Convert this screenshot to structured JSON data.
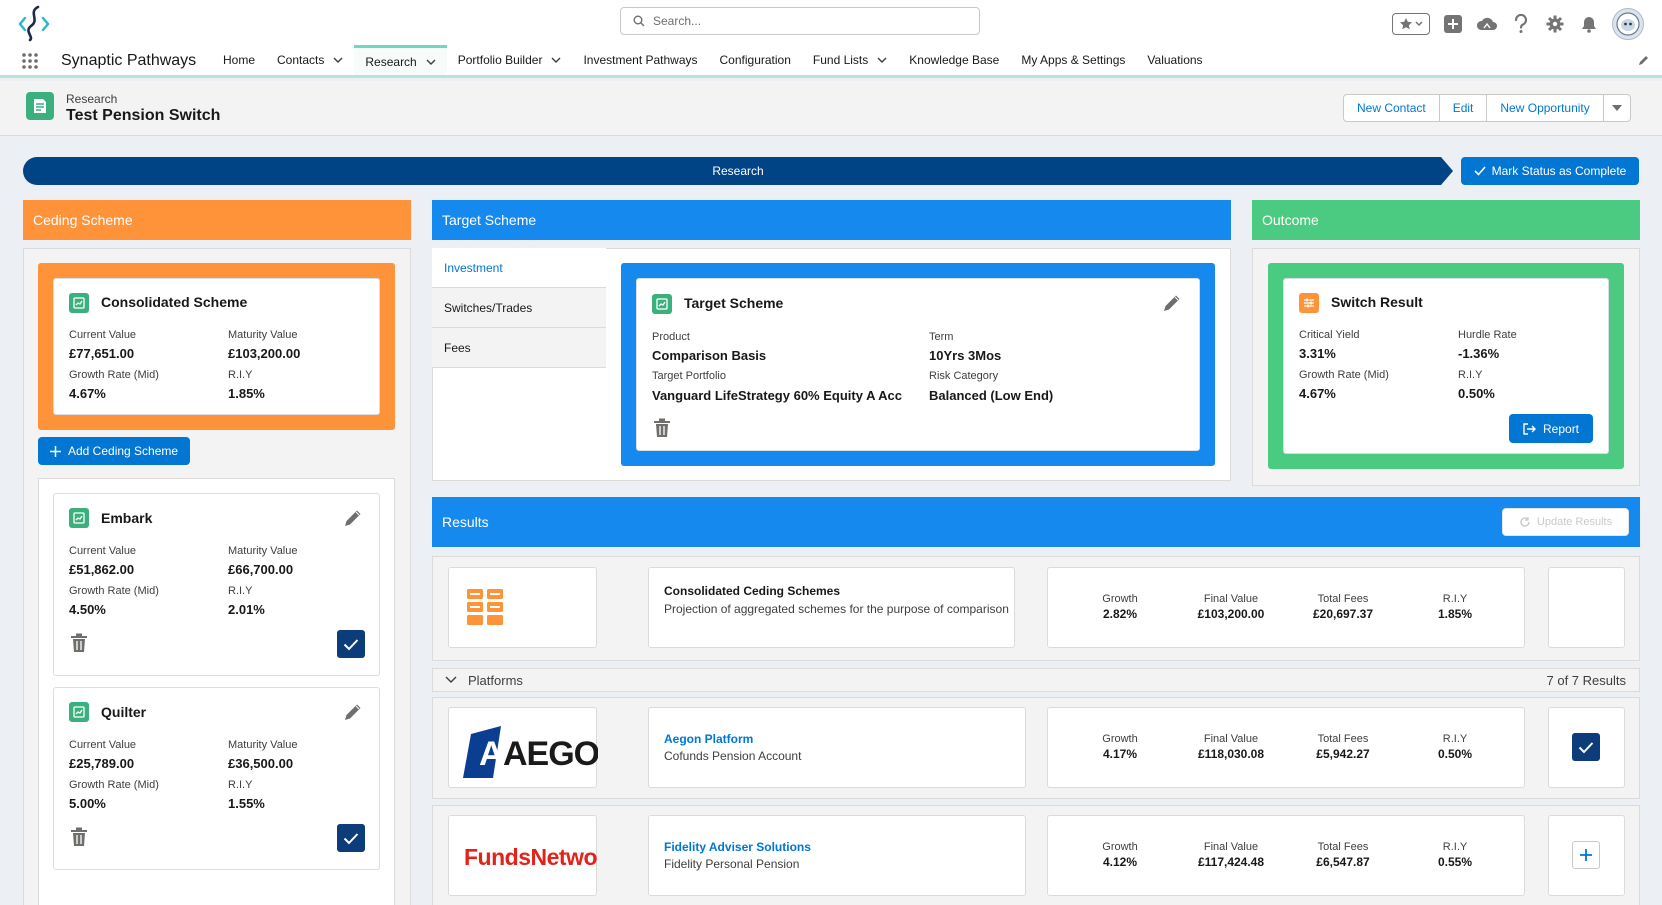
{
  "top": {
    "search_placeholder": "Search..."
  },
  "nav": {
    "app_name": "Synaptic Pathways",
    "items": [
      {
        "label": "Home",
        "chevron": false
      },
      {
        "label": "Contacts",
        "chevron": true
      },
      {
        "label": "Research",
        "chevron": true,
        "active": true
      },
      {
        "label": "Portfolio Builder",
        "chevron": true
      },
      {
        "label": "Investment Pathways",
        "chevron": false
      },
      {
        "label": "Configuration",
        "chevron": false
      },
      {
        "label": "Fund Lists",
        "chevron": true
      },
      {
        "label": "Knowledge Base",
        "chevron": false
      },
      {
        "label": "My Apps & Settings",
        "chevron": false
      },
      {
        "label": "Valuations",
        "chevron": false
      }
    ]
  },
  "record": {
    "object": "Research",
    "title": "Test Pension Switch",
    "buttons": {
      "new_contact": "New Contact",
      "edit": "Edit",
      "new_opportunity": "New Opportunity"
    }
  },
  "path": {
    "stage": "Research",
    "mark_complete": "Mark Status as Complete"
  },
  "colors": {
    "ceding": "#fe9339",
    "target": "#1589ee",
    "outcome": "#4bca81",
    "navy": "#0c3d7a"
  },
  "ceding": {
    "header": "Ceding Scheme",
    "consolidated": {
      "title": "Consolidated Scheme",
      "current_value_label": "Current Value",
      "current_value": "£77,651.00",
      "maturity_value_label": "Maturity Value",
      "maturity_value": "£103,200.00",
      "growth_label": "Growth Rate (Mid)",
      "growth": "4.67%",
      "riy_label": "R.I.Y",
      "riy": "1.85%"
    },
    "add_button": "Add Ceding Scheme",
    "schemes": [
      {
        "title": "Embark",
        "current_value_label": "Current Value",
        "current_value": "£51,862.00",
        "maturity_value_label": "Maturity Value",
        "maturity_value": "£66,700.00",
        "growth_label": "Growth Rate (Mid)",
        "growth": "4.50%",
        "riy_label": "R.I.Y",
        "riy": "2.01%"
      },
      {
        "title": "Quilter",
        "current_value_label": "Current Value",
        "current_value": "£25,789.00",
        "maturity_value_label": "Maturity Value",
        "maturity_value": "£36,500.00",
        "growth_label": "Growth Rate (Mid)",
        "growth": "5.00%",
        "riy_label": "R.I.Y",
        "riy": "1.55%"
      }
    ]
  },
  "target": {
    "header": "Target Scheme",
    "tabs": [
      "Investment",
      "Switches/Trades",
      "Fees"
    ],
    "card": {
      "title": "Target Scheme",
      "product_label": "Product",
      "product": "Comparison Basis",
      "term_label": "Term",
      "term": "10Yrs 3Mos",
      "portfolio_label": "Target Portfolio",
      "portfolio": "Vanguard LifeStrategy 60% Equity A Acc",
      "risk_label": "Risk Category",
      "risk": "Balanced (Low End)"
    }
  },
  "outcome": {
    "header": "Outcome",
    "card": {
      "title": "Switch Result",
      "critical_yield_label": "Critical Yield",
      "critical_yield": "3.31%",
      "hurdle_label": "Hurdle Rate",
      "hurdle": "-1.36%",
      "growth_label": "Growth Rate (Mid)",
      "growth": "4.67%",
      "riy_label": "R.I.Y",
      "riy": "0.50%",
      "report_button": "Report"
    }
  },
  "results": {
    "header": "Results",
    "update_button": "Update Results",
    "consolidated": {
      "title": "Consolidated Ceding Schemes",
      "desc": "Projection of aggregated schemes for the purpose of comparison",
      "growth_label": "Growth",
      "growth": "2.82%",
      "final_label": "Final Value",
      "final": "£103,200.00",
      "fees_label": "Total Fees",
      "fees": "£20,697.37",
      "riy_label": "R.I.Y",
      "riy": "1.85%"
    },
    "platforms_label": "Platforms",
    "count_label": "7 of 7 Results",
    "platforms": [
      {
        "logo_text": "AEGON",
        "name": "Aegon Platform",
        "product": "Cofunds Pension Account",
        "growth_label": "Growth",
        "growth": "4.17%",
        "final_label": "Final Value",
        "final": "£118,030.08",
        "fees_label": "Total Fees",
        "fees": "£5,942.27",
        "riy_label": "R.I.Y",
        "riy": "0.50%",
        "selected": true
      },
      {
        "logo_text": "FundsNetwork",
        "name": "Fidelity Adviser Solutions",
        "product": "Fidelity Personal Pension",
        "growth_label": "Growth",
        "growth": "4.12%",
        "final_label": "Final Value",
        "final": "£117,424.48",
        "fees_label": "Total Fees",
        "fees": "£6,547.87",
        "riy_label": "R.I.Y",
        "riy": "0.55%",
        "selected": false
      }
    ]
  }
}
